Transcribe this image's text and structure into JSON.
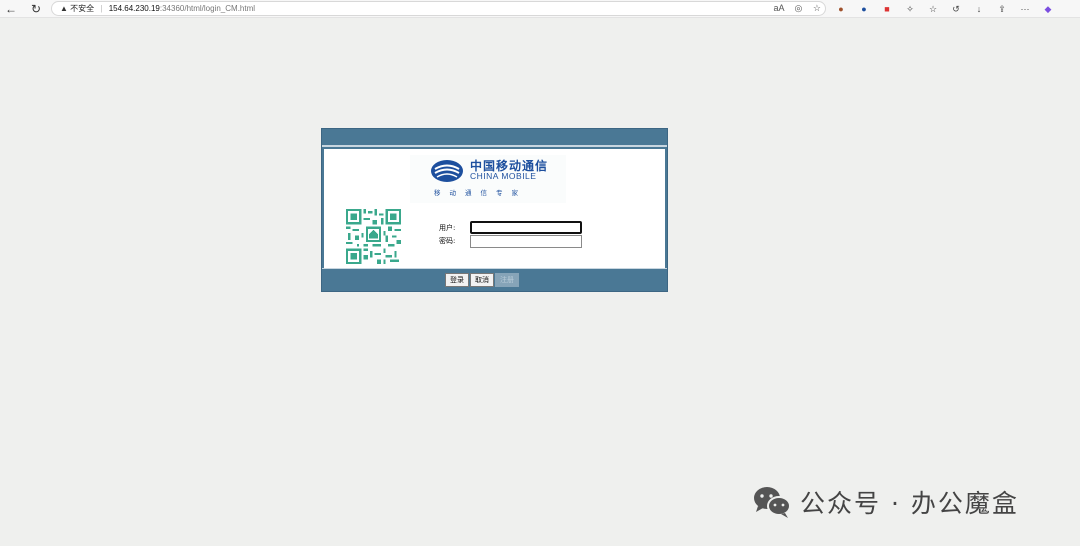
{
  "browser": {
    "security_label": "不安全",
    "url_host": "154.64.230.19",
    "url_rest": ":34360/html/login_CM.html"
  },
  "logo": {
    "cn_name": "中国移动通信",
    "en_name": "CHINA MOBILE",
    "slogan": "移动通信专家"
  },
  "form": {
    "username_label": "用户:",
    "password_label": "密码:",
    "username_value": "",
    "password_value": ""
  },
  "buttons": {
    "login": "登录",
    "cancel": "取消",
    "register": "注册"
  },
  "watermark": {
    "text": "公众号 · 办公魔盒"
  },
  "colors": {
    "page_bg": "#eff0ee",
    "frame": "#4a7895",
    "brand_blue": "#1d4f9e",
    "qr_green": "#3aa88c"
  }
}
